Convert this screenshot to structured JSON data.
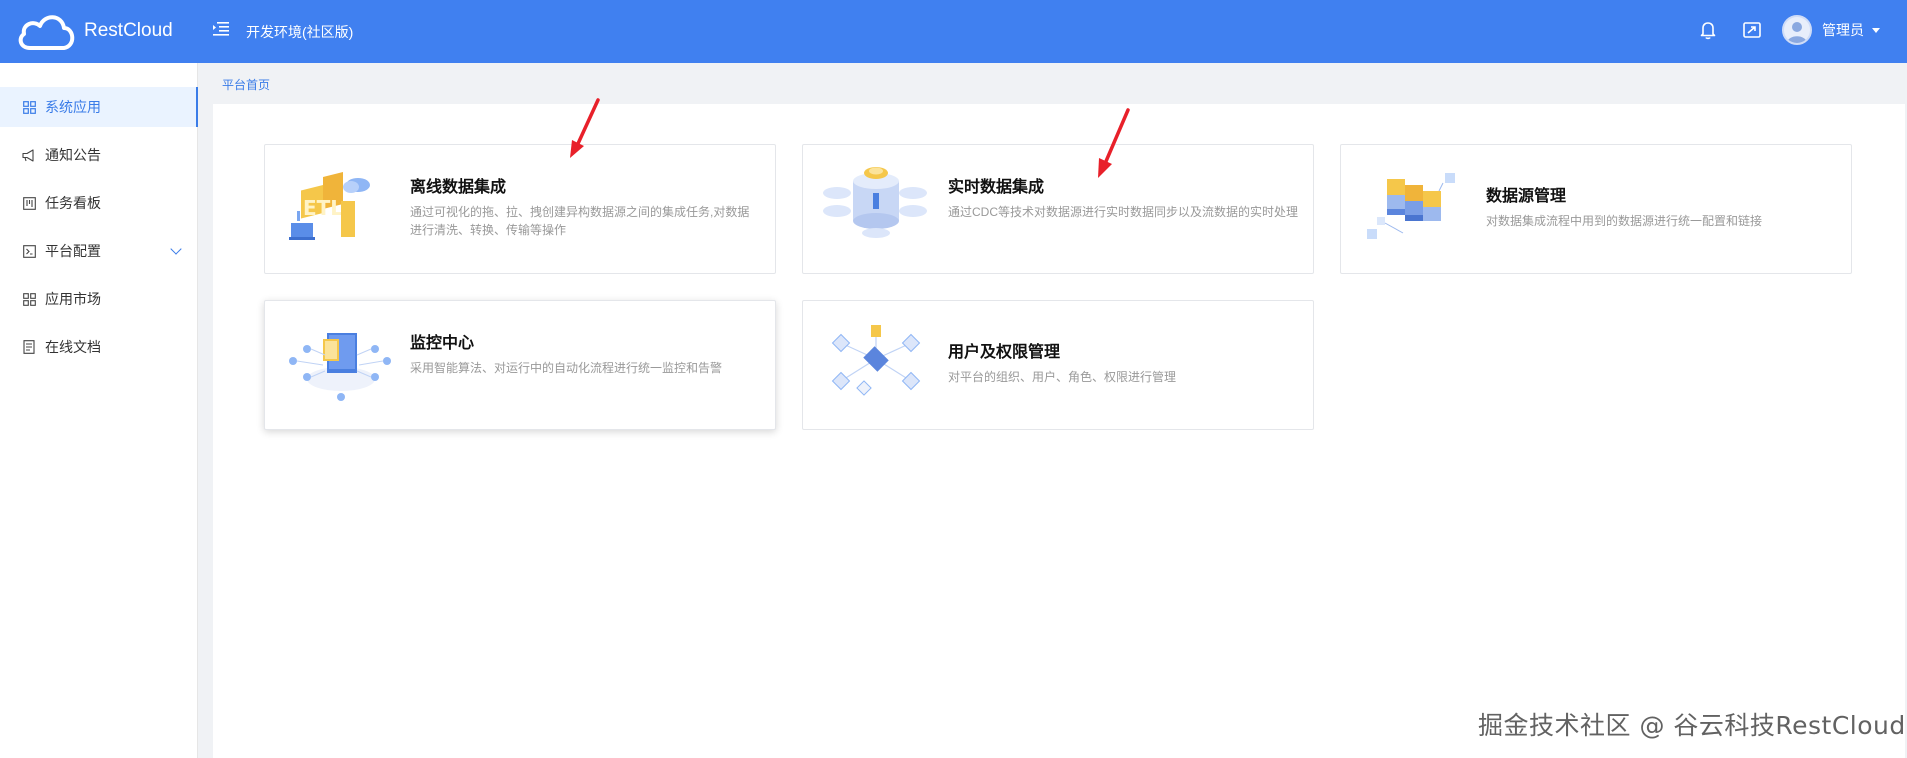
{
  "header": {
    "logo_text": "RestCloud",
    "env_title": "开发环境(社区版)",
    "user_name": "管理员",
    "icons": [
      "menu-fold-icon",
      "bell-icon",
      "screen-share-icon"
    ]
  },
  "sidebar": {
    "items": [
      {
        "label": "系统应用",
        "icon": "grid-icon",
        "active": true
      },
      {
        "label": "通知公告",
        "icon": "megaphone-icon"
      },
      {
        "label": "任务看板",
        "icon": "board-icon"
      },
      {
        "label": "平台配置",
        "icon": "terminal-icon",
        "expandable": true
      },
      {
        "label": "应用市场",
        "icon": "grid-icon"
      },
      {
        "label": "在线文档",
        "icon": "document-icon"
      }
    ]
  },
  "breadcrumb": "平台首页",
  "cards": [
    {
      "title": "离线数据集成",
      "desc": "通过可视化的拖、拉、拽创建异构数据源之间的集成任务,对数据进行清洗、转换、传输等操作",
      "icon": "etl-illustration"
    },
    {
      "title": "实时数据集成",
      "desc": "通过CDC等技术对数据源进行实时数据同步以及流数据的实时处理",
      "icon": "realtime-server-illustration"
    },
    {
      "title": "数据源管理",
      "desc": "对数据集成流程中用到的数据源进行统一配置和链接",
      "icon": "datasource-cubes-illustration"
    },
    {
      "title": "监控中心",
      "desc": "采用智能算法、对运行中的自动化流程进行统一监控和告警",
      "icon": "monitor-illustration"
    },
    {
      "title": "用户及权限管理",
      "desc": "对平台的组织、用户、角色、权限进行管理",
      "icon": "user-network-illustration"
    }
  ],
  "watermark": "掘金技术社区 @ 谷云科技RestCloud",
  "colors": {
    "header": "#4080f0",
    "accent": "#3a7ce8",
    "annotation_arrow": "#e8202a"
  }
}
